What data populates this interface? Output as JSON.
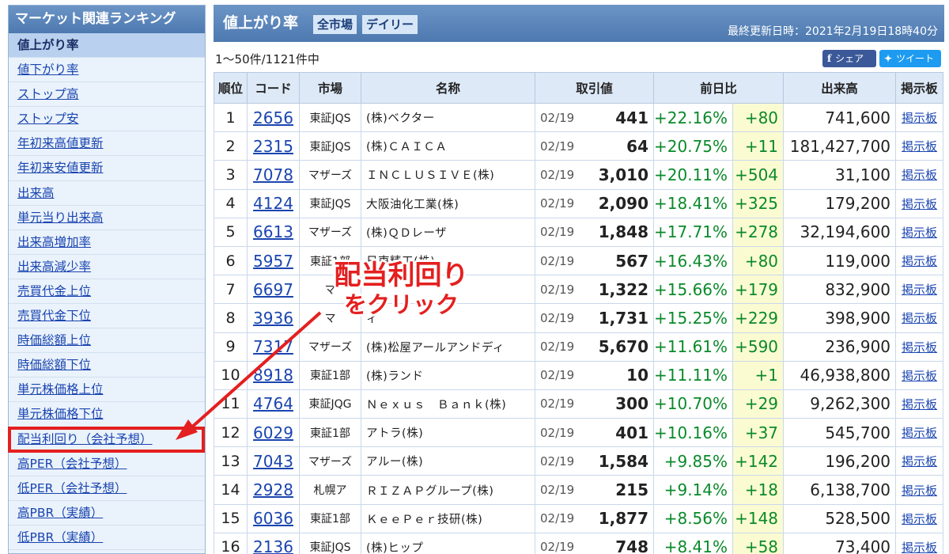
{
  "sidebar": {
    "title": "マーケット関連ランキング",
    "items": [
      {
        "label": "値上がり率",
        "active": true
      },
      {
        "label": "値下がり率"
      },
      {
        "label": "ストップ高"
      },
      {
        "label": "ストップ安"
      },
      {
        "label": "年初来高値更新"
      },
      {
        "label": "年初来安値更新"
      },
      {
        "label": "出来高"
      },
      {
        "label": "単元当り出来高"
      },
      {
        "label": "出来高増加率"
      },
      {
        "label": "出来高減少率"
      },
      {
        "label": "売買代金上位"
      },
      {
        "label": "売買代金下位"
      },
      {
        "label": "時価総額上位"
      },
      {
        "label": "時価総額下位"
      },
      {
        "label": "単元株価格上位"
      },
      {
        "label": "単元株価格下位"
      },
      {
        "label": "配当利回り（会社予想）",
        "highlighted": true
      },
      {
        "label": "高PER（会社予想）"
      },
      {
        "label": "低PER（会社予想）"
      },
      {
        "label": "高PBR（実績）"
      },
      {
        "label": "低PBR（実績）"
      }
    ]
  },
  "header": {
    "title": "値上がり率",
    "tab_market": "全市場",
    "tab_period": "デイリー",
    "updated": "最終更新日時：2021年2月19日18時40分"
  },
  "subbar": {
    "count": "1〜50件/1121件中",
    "facebook_label": "シェア",
    "twitter_label": "ツイート"
  },
  "table": {
    "headers": {
      "rank": "順位",
      "code": "コード",
      "market": "市場",
      "name": "名称",
      "price": "取引値",
      "change": "前日比",
      "volume": "出来高",
      "board": "掲示板"
    },
    "rows": [
      {
        "rank": "1",
        "code": "2656",
        "market": "東証JQS",
        "name": "(株)ベクター",
        "date": "02/19",
        "price": "441",
        "pct": "+22.16%",
        "chg": "+80",
        "volume": "741,600",
        "board": "掲示板"
      },
      {
        "rank": "2",
        "code": "2315",
        "market": "東証JQS",
        "name": "(株)ＣＡＩＣＡ",
        "date": "02/19",
        "price": "64",
        "pct": "+20.75%",
        "chg": "+11",
        "volume": "181,427,700",
        "board": "掲示板"
      },
      {
        "rank": "3",
        "code": "7078",
        "market": "マザーズ",
        "name": "ＩＮＣＬＵＳＩＶＥ(株)",
        "date": "02/19",
        "price": "3,010",
        "pct": "+20.11%",
        "chg": "+504",
        "volume": "31,100",
        "board": "掲示板"
      },
      {
        "rank": "4",
        "code": "4124",
        "market": "東証JQS",
        "name": "大阪油化工業(株)",
        "date": "02/19",
        "price": "2,090",
        "pct": "+18.41%",
        "chg": "+325",
        "volume": "179,200",
        "board": "掲示板"
      },
      {
        "rank": "5",
        "code": "6613",
        "market": "マザーズ",
        "name": "(株)ＱＤレーザ",
        "date": "02/19",
        "price": "1,848",
        "pct": "+17.71%",
        "chg": "+278",
        "volume": "32,194,600",
        "board": "掲示板"
      },
      {
        "rank": "6",
        "code": "5957",
        "market": "東証1部",
        "name": "日東精工(株)",
        "date": "02/19",
        "price": "567",
        "pct": "+16.43%",
        "chg": "+80",
        "volume": "119,000",
        "board": "掲示板"
      },
      {
        "rank": "7",
        "code": "6697",
        "market": "マ",
        "name": "",
        "date": "02/19",
        "price": "1,322",
        "pct": "+15.66%",
        "chg": "+179",
        "volume": "832,900",
        "board": "掲示板"
      },
      {
        "rank": "8",
        "code": "3936",
        "market": "マ",
        "name": "ィ",
        "date": "02/19",
        "price": "1,731",
        "pct": "+15.25%",
        "chg": "+229",
        "volume": "398,900",
        "board": "掲示板"
      },
      {
        "rank": "9",
        "code": "7317",
        "market": "マザーズ",
        "name": "(株)松屋アールアンドディ",
        "date": "02/19",
        "price": "5,670",
        "pct": "+11.61%",
        "chg": "+590",
        "volume": "236,900",
        "board": "掲示板"
      },
      {
        "rank": "10",
        "code": "8918",
        "market": "東証1部",
        "name": "(株)ランド",
        "date": "02/19",
        "price": "10",
        "pct": "+11.11%",
        "chg": "+1",
        "volume": "46,938,800",
        "board": "掲示板"
      },
      {
        "rank": "11",
        "code": "4764",
        "market": "東証JQG",
        "name": "Ｎｅｘｕｓ　Ｂａｎｋ(株)",
        "date": "02/19",
        "price": "300",
        "pct": "+10.70%",
        "chg": "+29",
        "volume": "9,262,300",
        "board": "掲示板"
      },
      {
        "rank": "12",
        "code": "6029",
        "market": "東証1部",
        "name": "アトラ(株)",
        "date": "02/19",
        "price": "401",
        "pct": "+10.16%",
        "chg": "+37",
        "volume": "545,700",
        "board": "掲示板"
      },
      {
        "rank": "13",
        "code": "7043",
        "market": "マザーズ",
        "name": "アルー(株)",
        "date": "02/19",
        "price": "1,584",
        "pct": "+9.85%",
        "chg": "+142",
        "volume": "196,200",
        "board": "掲示板"
      },
      {
        "rank": "14",
        "code": "2928",
        "market": "札幌ア",
        "name": "ＲＩＺＡＰグループ(株)",
        "date": "02/19",
        "price": "215",
        "pct": "+9.14%",
        "chg": "+18",
        "volume": "6,138,700",
        "board": "掲示板"
      },
      {
        "rank": "15",
        "code": "6036",
        "market": "東証1部",
        "name": "ＫｅｅＰｅｒ技研(株)",
        "date": "02/19",
        "price": "1,877",
        "pct": "+8.56%",
        "chg": "+148",
        "volume": "528,500",
        "board": "掲示板"
      },
      {
        "rank": "16",
        "code": "2136",
        "market": "東証JQS",
        "name": "(株)ヒップ",
        "date": "02/19",
        "price": "748",
        "pct": "+8.41%",
        "chg": "+58",
        "volume": "73,400",
        "board": "掲示板"
      }
    ]
  },
  "annotation": {
    "line1": "配当利回り",
    "line2": "をクリック",
    "color": "#e41f1f"
  },
  "icons": {
    "facebook": "facebook-icon",
    "twitter": "twitter-bird-icon"
  }
}
